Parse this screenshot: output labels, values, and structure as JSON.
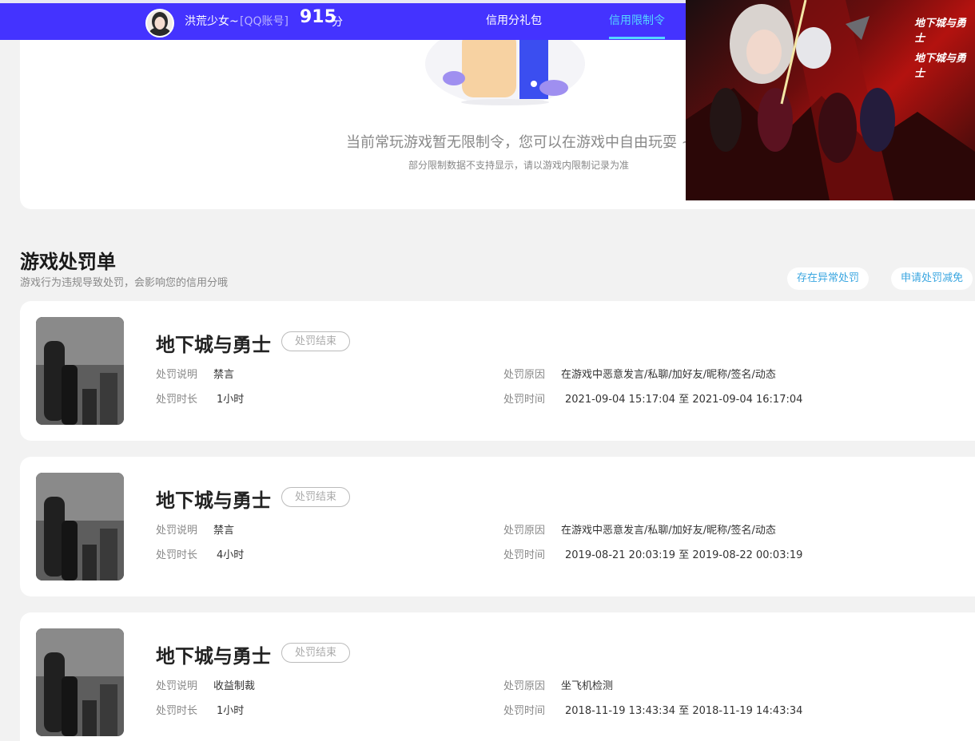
{
  "header": {
    "username": "洪荒少女~",
    "account_type": "[QQ账号]",
    "score": "915",
    "score_unit": "分",
    "tabs": [
      {
        "label": "信用分礼包"
      },
      {
        "label": "信用限制令"
      }
    ],
    "active_color": "#55d6ff",
    "bar_color": "#4433ff"
  },
  "restriction": {
    "empty_message": "当前常玩游戏暂无限制令，您可以在游戏中自由玩耍 ~",
    "empty_sub": "部分限制数据不支持显示，请以游戏内限制记录为准"
  },
  "banner": {
    "logo_text": "地下城与勇士"
  },
  "penalties": {
    "title": "游戏处罚单",
    "subtitle": "游戏行为违规导致处罚，会影响您的信用分哦",
    "actions": [
      {
        "label": "存在异常处罚"
      },
      {
        "label": "申请处罚减免"
      }
    ],
    "labels": {
      "desc": "处罚说明",
      "duration": "处罚时长",
      "reason": "处罚原因",
      "time": "处罚时间"
    },
    "records": [
      {
        "game": "地下城与勇士",
        "status": "处罚结束",
        "desc": "禁言",
        "duration": "1小时",
        "reason": "在游戏中恶意发言/私聊/加好友/昵称/签名/动态",
        "time": "2021-09-04 15:17:04 至 2021-09-04 16:17:04"
      },
      {
        "game": "地下城与勇士",
        "status": "处罚结束",
        "desc": "禁言",
        "duration": "4小时",
        "reason": "在游戏中恶意发言/私聊/加好友/昵称/签名/动态",
        "time": "2019-08-21 20:03:19 至 2019-08-22 00:03:19"
      },
      {
        "game": "地下城与勇士",
        "status": "处罚结束",
        "desc": "收益制裁",
        "duration": "1小时",
        "reason": "坐飞机检测",
        "time": "2018-11-19 13:43:34 至 2018-11-19 14:43:34"
      }
    ]
  }
}
